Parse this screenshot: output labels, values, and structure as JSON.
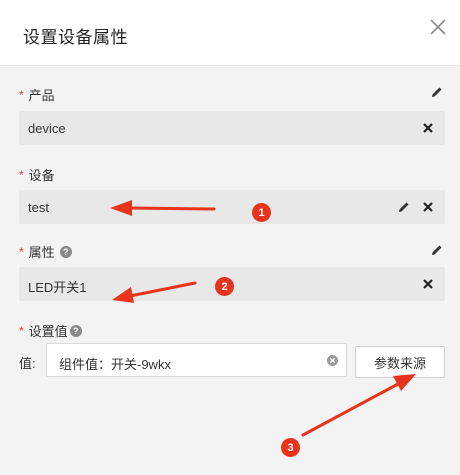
{
  "dialog": {
    "title": "设置设备属性"
  },
  "fields": {
    "required_mark": "*",
    "product": {
      "label": "产品",
      "value": "device"
    },
    "device": {
      "label": "设备",
      "value": "test"
    },
    "property": {
      "label": "属性",
      "value": "LED开关1"
    },
    "setting_value": {
      "label": "设置值"
    }
  },
  "value_row": {
    "prefix_label": "值:",
    "input_value": "组件值：开关-9wkx",
    "param_source_button": "参数来源"
  },
  "annotations": {
    "badges": [
      "1",
      "2",
      "3"
    ],
    "color": "#e8341c"
  },
  "icons": {
    "close": "close-icon",
    "edit": "pencil-icon",
    "clear": "x-icon",
    "help": "question-icon"
  },
  "help_glyph": "?"
}
